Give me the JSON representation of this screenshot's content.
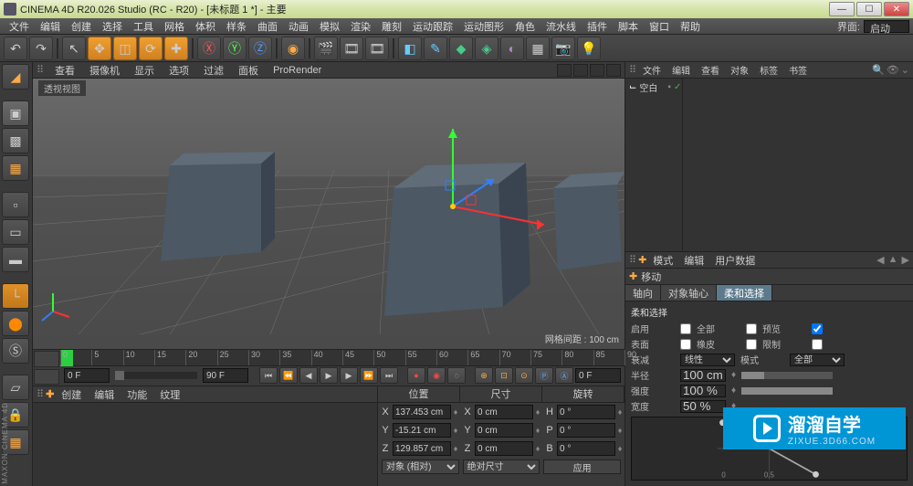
{
  "title": "CINEMA 4D R20.026 Studio (RC - R20) - [未标题 1 *] - 主要",
  "menus": [
    "文件",
    "编辑",
    "创建",
    "选择",
    "工具",
    "网格",
    "体积",
    "样条",
    "曲面",
    "动画",
    "模拟",
    "渲染",
    "雕刻",
    "运动跟踪",
    "运动图形",
    "角色",
    "流水线",
    "插件",
    "脚本",
    "窗口",
    "帮助"
  ],
  "layout_label": "界面:",
  "layout_value": "启动",
  "viewport": {
    "tabs": [
      "查看",
      "摄像机",
      "显示",
      "选项",
      "过滤",
      "面板",
      "ProRender"
    ],
    "label": "透视视图",
    "status_label": "网格间距 :",
    "status_value": "100 cm"
  },
  "timeline": {
    "start": "0 F",
    "end": "90 F",
    "current": "0 F",
    "marks": [
      0,
      5,
      10,
      15,
      20,
      25,
      30,
      35,
      40,
      45,
      50,
      55,
      60,
      65,
      70,
      75,
      80,
      85,
      90
    ]
  },
  "bottom_tabs": [
    "创建",
    "编辑",
    "功能",
    "纹理"
  ],
  "coord": {
    "headers": [
      "位置",
      "尺寸",
      "旋转"
    ],
    "rows": [
      {
        "axis": "X",
        "pos": "137.453 cm",
        "size": "0 cm",
        "rot": "0 °"
      },
      {
        "axis": "Y",
        "pos": "-15.21 cm",
        "size": "0 cm",
        "rot": "0 °"
      },
      {
        "axis": "Z",
        "pos": "129.857 cm",
        "size": "0 cm",
        "rot": "0 °"
      }
    ],
    "mode1": "对象 (相对)",
    "mode2": "绝对尺寸",
    "apply": "应用"
  },
  "right": {
    "obj_tabs": [
      "文件",
      "编辑",
      "查看",
      "对象",
      "标签",
      "书签"
    ],
    "object_name": "空白",
    "mode_tabs": [
      "模式",
      "编辑",
      "用户数据"
    ],
    "attr_title": "移动",
    "attr_tabs": [
      "轴向",
      "对象轴心",
      "柔和选择"
    ],
    "attr_active": 2,
    "section": "柔和选择",
    "rows": {
      "enable": "启用",
      "entire": "全部",
      "preview": "预览",
      "surface": "表面",
      "eraser": "橡皮",
      "limit": "限制",
      "falloff": "衰减",
      "falloff_mode": "线性",
      "mode_lbl": "模式",
      "mode_val": "全部",
      "radius": "半径",
      "radius_val": "100 cm",
      "strength": "强度",
      "strength_val": "100 %",
      "width": "宽度",
      "width_val": "50 %"
    }
  },
  "watermark": {
    "t1": "溜溜自学",
    "t2": "ZIXUE.3D66.COM"
  },
  "brand": "MAXON CINEMA 4D"
}
